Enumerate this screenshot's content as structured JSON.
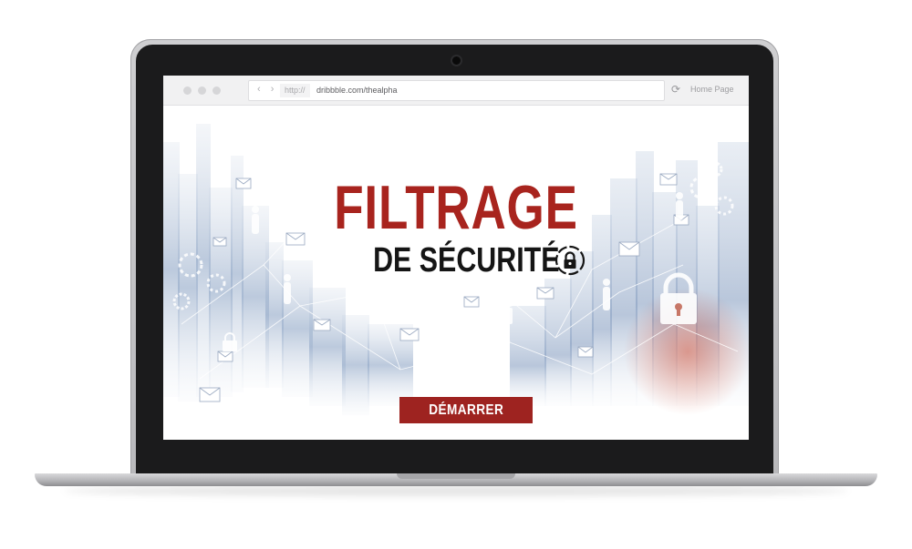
{
  "browser": {
    "url_prefix": "http://",
    "url": "dribbble.com/thealpha",
    "home_link": "Home Page",
    "nav_arrows": "‹ ›",
    "reload_icon": "reload-icon"
  },
  "hero": {
    "title": "FILTRAGE",
    "subtitle": "DE SÉCURITÉ",
    "subtitle_icon": "padlock-icon",
    "cta_label": "DÉMARRER"
  },
  "colors": {
    "accent_red": "#a8241e",
    "button_red": "#9e2320",
    "subtitle_dark": "#151515",
    "bg_blue": "#9fb4cf"
  }
}
